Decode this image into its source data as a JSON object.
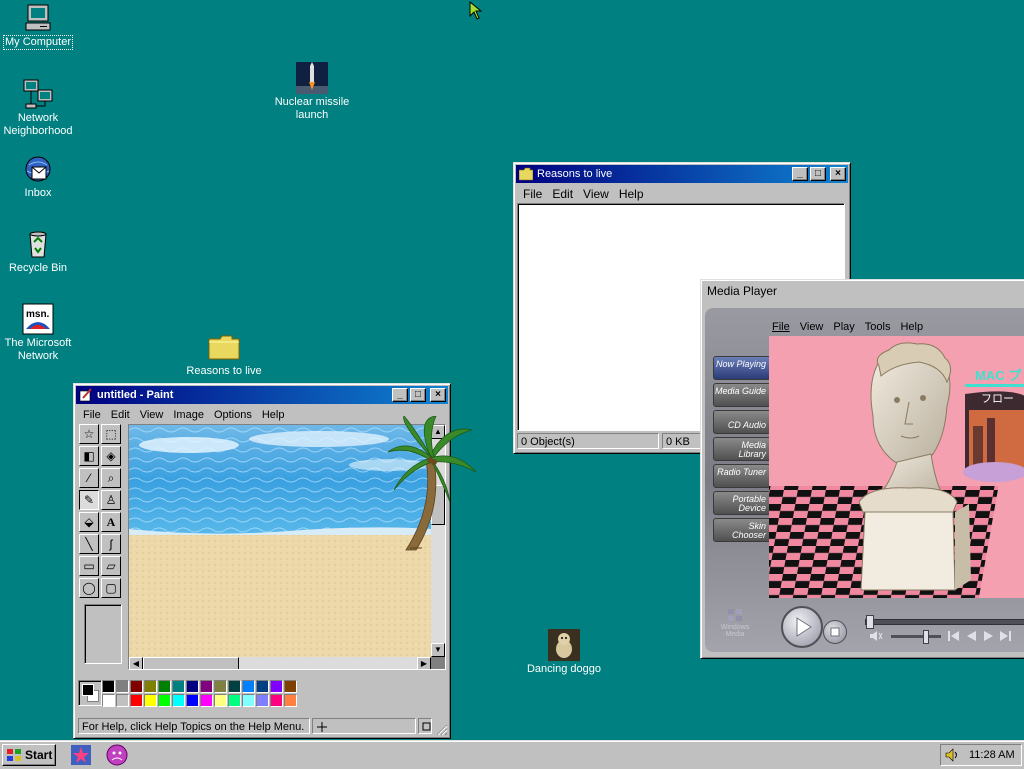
{
  "desktop": {
    "icons": [
      {
        "label": "My Computer",
        "icon": "my-computer-icon"
      },
      {
        "label": "Network Neighborhood",
        "icon": "network-neighborhood-icon"
      },
      {
        "label": "Inbox",
        "icon": "inbox-icon"
      },
      {
        "label": "Recycle Bin",
        "icon": "recycle-bin-icon"
      },
      {
        "label": "The Microsoft Network",
        "icon": "msn-icon"
      },
      {
        "label": "Nuclear missile launch",
        "icon": "missile-launch-icon"
      },
      {
        "label": "Reasons to live",
        "icon": "folder-icon"
      },
      {
        "label": "Dancing doggo",
        "icon": "dog-icon"
      }
    ],
    "msn_logo_text": "msn."
  },
  "explorer": {
    "title": "Reasons to live",
    "menu": [
      "File",
      "Edit",
      "View",
      "Help"
    ],
    "status_objects": "0 Object(s)",
    "status_size": "0 KB"
  },
  "paint": {
    "title": "untitled - Paint",
    "menu": [
      "File",
      "Edit",
      "View",
      "Image",
      "Options",
      "Help"
    ],
    "status_help": "For Help, click Help Topics on the Help Menu.",
    "tool_glyphs": [
      "☆",
      "⬚",
      "◧",
      "◈",
      "⁄",
      "⌕",
      "✎",
      "♙",
      "⬙",
      "A",
      "╲",
      "ʃ",
      "▭",
      "▱",
      "◯",
      "▢"
    ],
    "palette": [
      "#000000",
      "#808080",
      "#800000",
      "#808000",
      "#008000",
      "#008080",
      "#000080",
      "#800080",
      "#808040",
      "#004040",
      "#0080ff",
      "#004080",
      "#8000ff",
      "#804000",
      "#ffffff",
      "#c0c0c0",
      "#ff0000",
      "#ffff00",
      "#00ff00",
      "#00ffff",
      "#0000ff",
      "#ff00ff",
      "#ffff80",
      "#00ff80",
      "#80ffff",
      "#8080ff",
      "#ff0080",
      "#ff8040"
    ]
  },
  "media_player": {
    "title": "Media Player",
    "menu": [
      "File",
      "View",
      "Play",
      "Tools",
      "Help"
    ],
    "nav": [
      "Now Playing",
      "Media Guide",
      "CD Audio",
      "Media Library",
      "Radio Tuner",
      "Portable Device",
      "Skin Chooser"
    ],
    "album_text_1": "MAC プ",
    "album_text_2": "フロー",
    "logo_text": "Windows Media",
    "progress": 0.0,
    "volume": 0.7
  },
  "taskbar": {
    "start_label": "Start",
    "clock": "11:28 AM"
  }
}
